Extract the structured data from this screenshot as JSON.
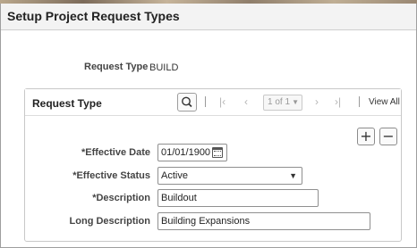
{
  "page": {
    "title": "Setup Project Request Types"
  },
  "summary": {
    "label": "Request Type",
    "value": "BUILD"
  },
  "group": {
    "title": "Request Type",
    "pagination": {
      "current": "1 of 1",
      "view_all": "View All"
    },
    "add_label": "+",
    "delete_label": "−"
  },
  "form": {
    "effective_date": {
      "label": "*Effective Date",
      "value": "01/01/1900"
    },
    "effective_status": {
      "label": "*Effective Status",
      "value": "Active"
    },
    "description": {
      "label": "*Description",
      "value": "Buildout"
    },
    "long_description": {
      "label": "Long Description",
      "value": "Building Expansions"
    }
  },
  "icons": {
    "search": "search-icon",
    "first": "first-page-icon",
    "prev": "previous-icon",
    "next": "next-icon",
    "last": "last-page-icon",
    "calendar": "calendar-icon"
  }
}
